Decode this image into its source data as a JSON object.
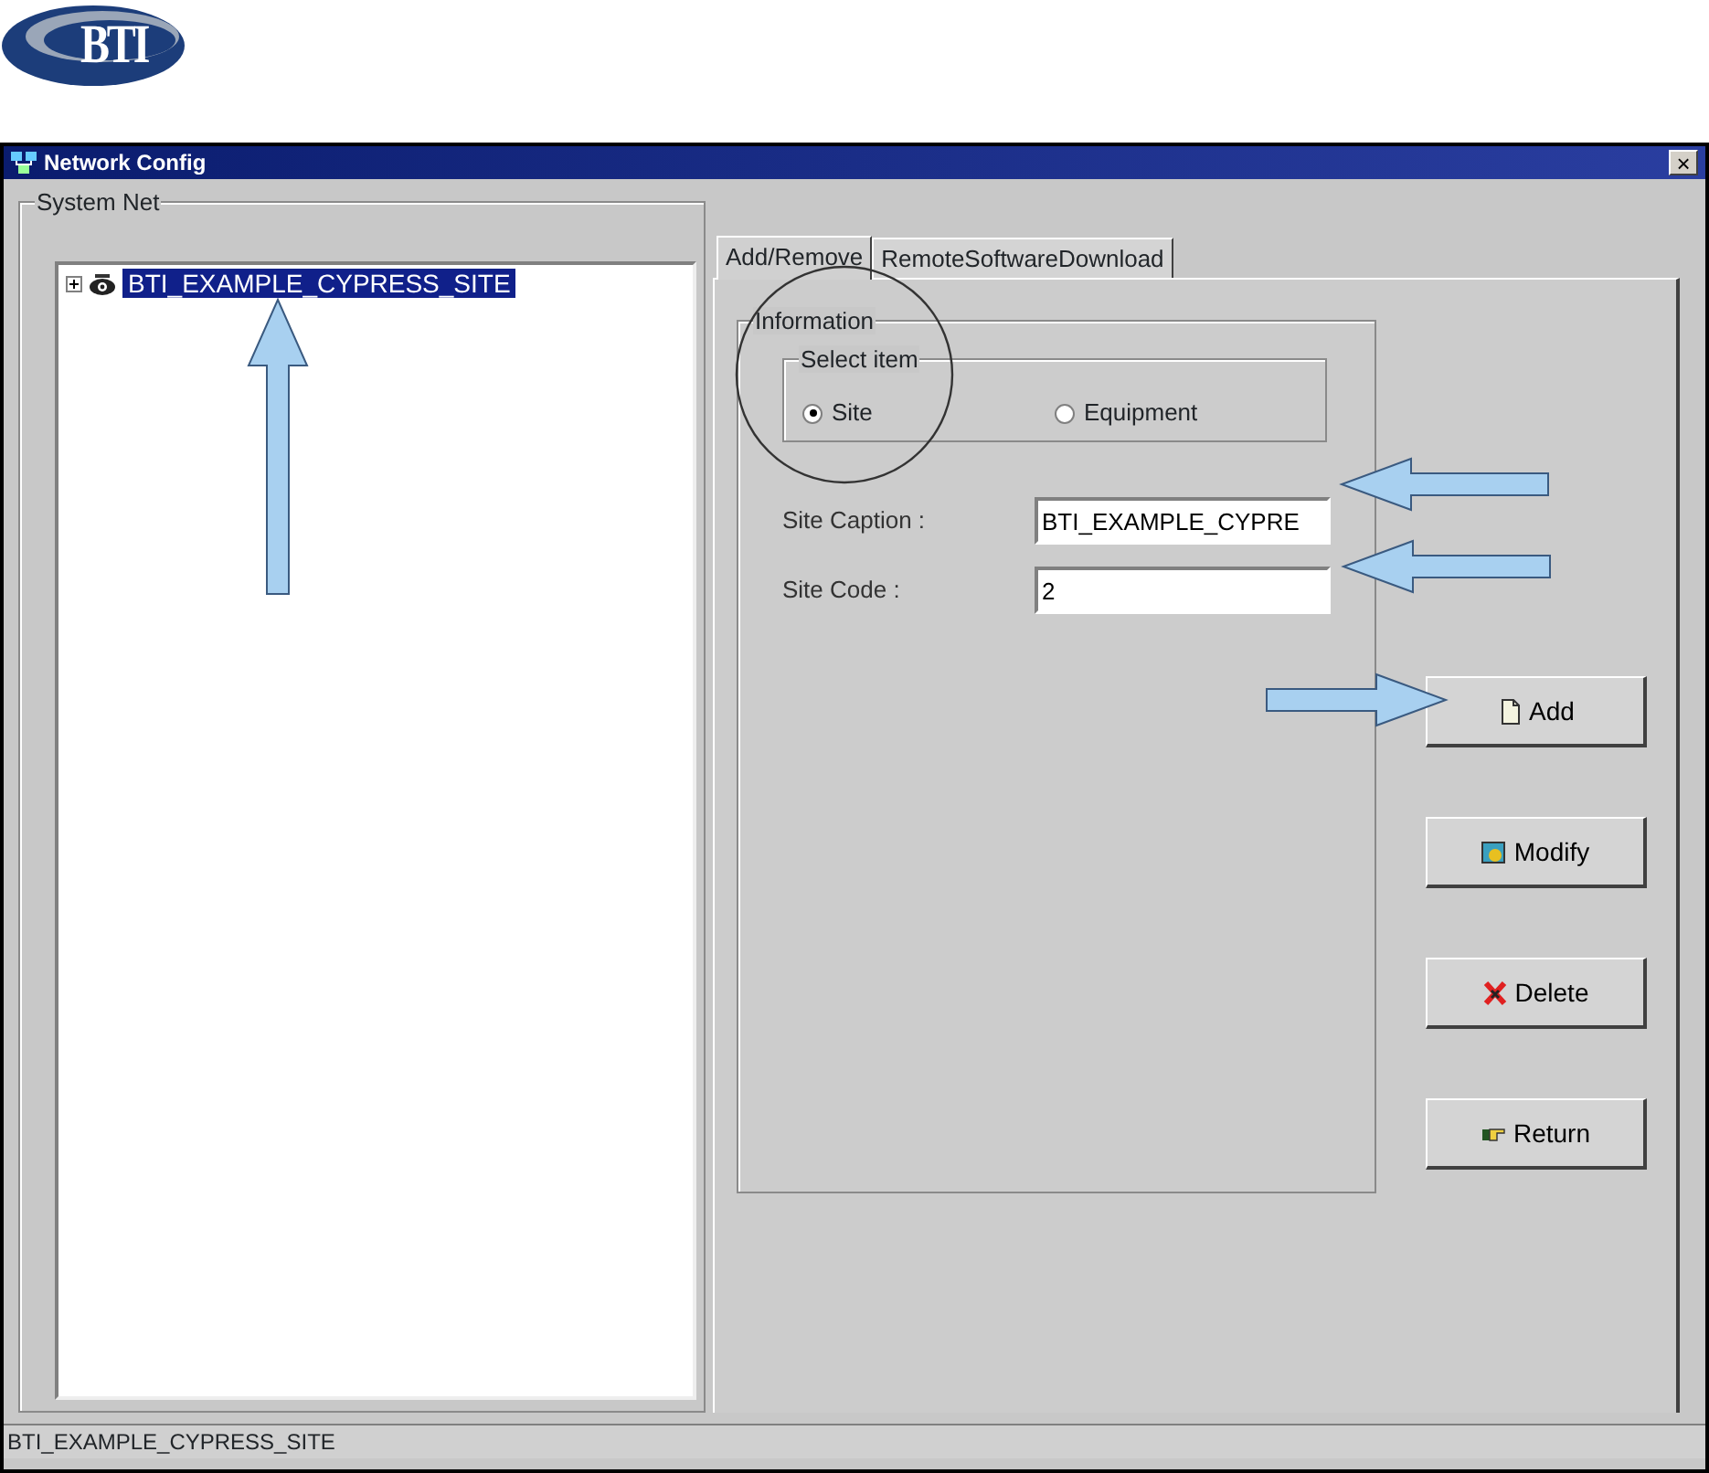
{
  "logo": {
    "text": "BTI"
  },
  "window": {
    "title": "Network Config",
    "close": "×"
  },
  "tree": {
    "label": "System Net",
    "items": [
      {
        "label": "BTI_EXAMPLE_CYPRESS_SITE",
        "expanded": false,
        "selected": true
      }
    ]
  },
  "tabs": [
    {
      "label": "Add/Remove",
      "selected": true
    },
    {
      "label": "RemoteSoftwareDownload",
      "selected": false
    }
  ],
  "information": {
    "label": "Information",
    "select_item": {
      "label": "Select item",
      "options": [
        {
          "label": "Site",
          "selected": true
        },
        {
          "label": "Equipment",
          "selected": false
        }
      ]
    },
    "fields": [
      {
        "label": "Site Caption :",
        "value": "BTI_EXAMPLE_CYPRE"
      },
      {
        "label": "Site Code :",
        "value": "2"
      }
    ]
  },
  "buttons": [
    {
      "label": "Add",
      "kind": "add"
    },
    {
      "label": "Modify",
      "kind": "modify"
    },
    {
      "label": "Delete",
      "kind": "delete"
    },
    {
      "label": "Return",
      "kind": "return"
    }
  ],
  "status_bar": "BTI_EXAMPLE_CYPRESS_SITE"
}
